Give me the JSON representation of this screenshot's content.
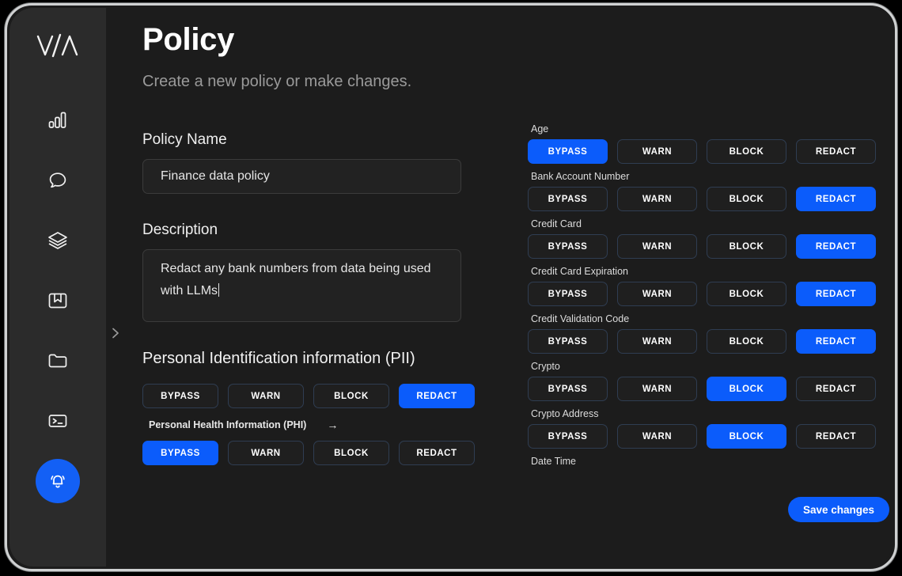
{
  "app": {
    "logo_text": "V/\\"
  },
  "sidebar": {
    "items": [
      {
        "name": "analytics",
        "icon": "bar-chart-icon",
        "active": false
      },
      {
        "name": "chat",
        "icon": "chat-bubble-icon",
        "active": false
      },
      {
        "name": "layers",
        "icon": "layers-icon",
        "active": false
      },
      {
        "name": "bookmarks",
        "icon": "book-icon",
        "active": false
      },
      {
        "name": "files",
        "icon": "folder-icon",
        "active": false
      },
      {
        "name": "terminal",
        "icon": "terminal-icon",
        "active": false
      },
      {
        "name": "notifications",
        "icon": "bell-icon",
        "active": true
      }
    ],
    "expand_icon": "chevron-right-icon"
  },
  "header": {
    "title": "Policy",
    "subtitle": "Create a new policy or make changes."
  },
  "form": {
    "policy_name_label": "Policy Name",
    "policy_name_value": "Finance data policy",
    "policy_name_placeholder": "Finance data policy",
    "description_label": "Description",
    "description_value": "Redact any bank numbers from data being used with LLMs",
    "description_placeholder": "Description"
  },
  "actions": {
    "bypass": "BYPASS",
    "warn": "WARN",
    "block": "BLOCK",
    "redact": "REDACT"
  },
  "pii": {
    "heading": "Personal Identification information (PII)",
    "selected": "REDACT",
    "sub_label": "Personal Health Information (PHI)",
    "sub_arrow": "→",
    "sub_selected": "BYPASS"
  },
  "categories": [
    {
      "label": "Age",
      "selected": "BYPASS"
    },
    {
      "label": "Bank Account Number",
      "selected": "REDACT"
    },
    {
      "label": "Credit Card",
      "selected": "REDACT"
    },
    {
      "label": "Credit Card Expiration",
      "selected": "REDACT"
    },
    {
      "label": "Credit Validation Code",
      "selected": "REDACT"
    },
    {
      "label": "Crypto",
      "selected": "BLOCK"
    },
    {
      "label": "Crypto Address",
      "selected": "BLOCK"
    },
    {
      "label": "Date Time",
      "selected": null
    }
  ],
  "footer": {
    "save_label": "Save changes"
  },
  "colors": {
    "accent": "#0b5cfb",
    "sidebar_bg": "#2b2b2b",
    "content_bg": "#1c1c1c",
    "input_bg": "#222222",
    "frame": "#cfd1d2"
  }
}
